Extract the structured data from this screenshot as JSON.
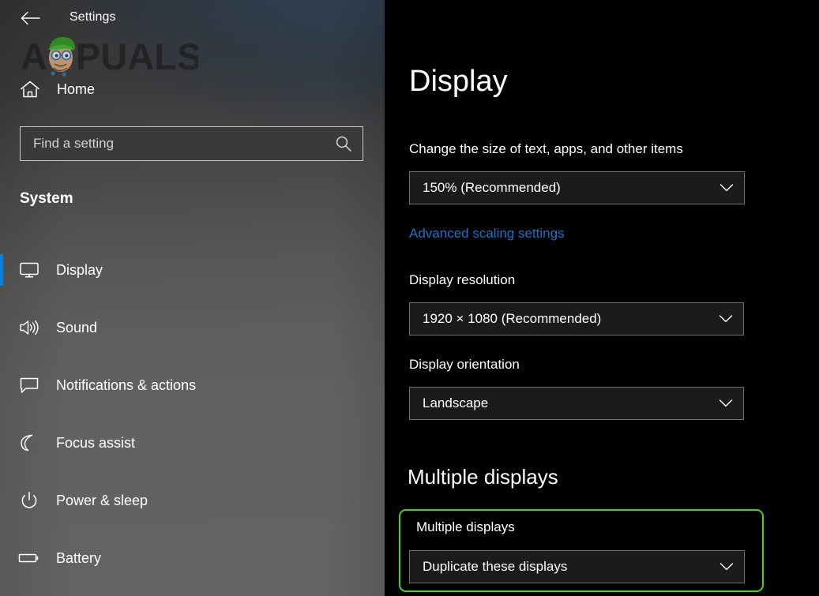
{
  "window": {
    "title": "Settings",
    "back_icon": "back-arrow-icon"
  },
  "watermark": {
    "text": "APPUALS",
    "brand_mark": "appuals-mascot-icon"
  },
  "sidebar": {
    "home": {
      "label": "Home",
      "icon": "home-icon"
    },
    "search": {
      "placeholder": "Find a setting",
      "value": "",
      "icon": "search-icon"
    },
    "section_title": "System",
    "accent_color": "#0a7fd6",
    "items": [
      {
        "label": "Display",
        "icon": "monitor-icon",
        "selected": true
      },
      {
        "label": "Sound",
        "icon": "speaker-icon",
        "selected": false
      },
      {
        "label": "Notifications & actions",
        "icon": "chat-bubble-icon",
        "selected": false
      },
      {
        "label": "Focus assist",
        "icon": "moon-icon",
        "selected": false
      },
      {
        "label": "Power & sleep",
        "icon": "power-icon",
        "selected": false
      },
      {
        "label": "Battery",
        "icon": "battery-icon",
        "selected": false
      }
    ]
  },
  "main": {
    "page_title": "Display",
    "scale": {
      "label": "Change the size of text, apps, and other items",
      "value": "150% (Recommended)",
      "chevron_icon": "chevron-down-icon"
    },
    "advanced_scaling_link": "Advanced scaling settings",
    "resolution": {
      "label": "Display resolution",
      "value": "1920 × 1080 (Recommended)",
      "chevron_icon": "chevron-down-icon"
    },
    "orientation": {
      "label": "Display orientation",
      "value": "Landscape",
      "chevron_icon": "chevron-down-icon"
    },
    "multiple_displays": {
      "heading": "Multiple displays",
      "label": "Multiple displays",
      "value": "Duplicate these displays",
      "chevron_icon": "chevron-down-icon",
      "highlight_color": "#4ad312"
    }
  }
}
